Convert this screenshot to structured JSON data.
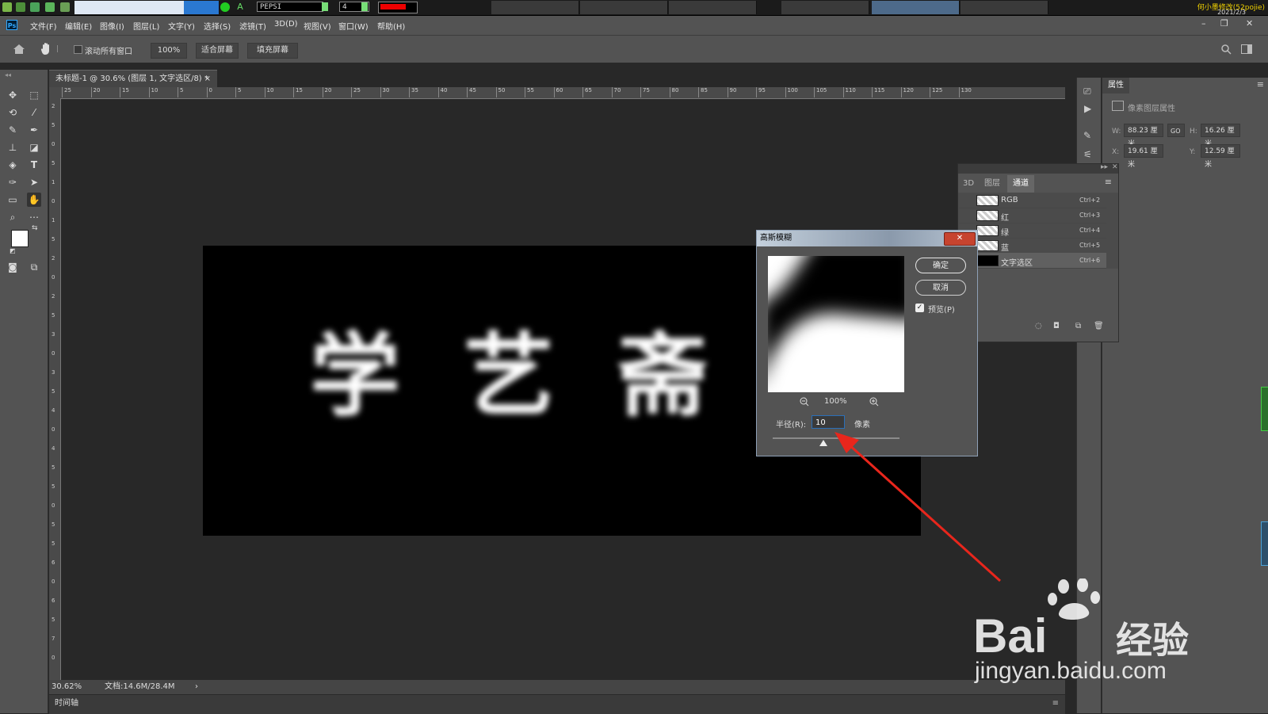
{
  "taskbar": {
    "text_field": "PEPSI",
    "num_field": "4",
    "brush_color": "#e00000",
    "right_text": "何小墨修改(52pojie)",
    "date": "2021/2/3"
  },
  "menubar": {
    "logo": "Ps",
    "items": [
      "文件(F)",
      "编辑(E)",
      "图像(I)",
      "图层(L)",
      "文字(Y)",
      "选择(S)",
      "滤镜(T)",
      "3D(D)",
      "视图(V)",
      "窗口(W)",
      "帮助(H)"
    ],
    "win_min": "–",
    "win_restore": "❐",
    "win_close": "✕"
  },
  "options": {
    "scroll_all_label": "滚动所有窗口",
    "zoom_value": "100%",
    "fit_screen": "适合屏幕",
    "fill_screen": "填充屏幕"
  },
  "document": {
    "tab_title": "未标题-1 @ 30.6% (图层 1, 文字选区/8) *",
    "tab_close": "×",
    "image_text": "学艺斋",
    "zoom": "30.62%",
    "doc_size": "文档:14.6M/28.4M",
    "status_arrow": "›"
  },
  "ruler": {
    "top_ticks": [
      "25",
      "20",
      "15",
      "10",
      "5",
      "0",
      "5",
      "10",
      "15",
      "20",
      "25",
      "30",
      "35",
      "40",
      "45",
      "50",
      "55",
      "60",
      "65",
      "70",
      "75",
      "80",
      "85",
      "90",
      "95",
      "100",
      "105",
      "110",
      "115",
      "120",
      "125",
      "130"
    ],
    "left_ticks": [
      "2",
      "5",
      "0",
      "5",
      "1",
      "0",
      "1",
      "5",
      "2",
      "0",
      "2",
      "5",
      "3",
      "0",
      "3",
      "5",
      "4",
      "0",
      "4",
      "5",
      "5",
      "0",
      "5",
      "5",
      "6",
      "0",
      "6",
      "5",
      "7",
      "0"
    ]
  },
  "timeline": {
    "label": "时间轴"
  },
  "properties": {
    "tab": "属性",
    "sub": "像素图层属性",
    "w_label": "W:",
    "w_value": "88.23 厘米",
    "link": "GO",
    "h_label": "H:",
    "h_value": "16.26 厘米",
    "x_label": "X:",
    "x_value": "19.61 厘米",
    "y_label": "Y:",
    "y_value": "12.59 厘米"
  },
  "channels": {
    "tabs": [
      "3D",
      "图层",
      "通道"
    ],
    "rows": [
      {
        "name": "RGB",
        "shortcut": "Ctrl+2"
      },
      {
        "name": "红",
        "shortcut": "Ctrl+3"
      },
      {
        "name": "绿",
        "shortcut": "Ctrl+4"
      },
      {
        "name": "蓝",
        "shortcut": "Ctrl+5"
      },
      {
        "name": "文字选区",
        "shortcut": "Ctrl+6"
      }
    ]
  },
  "dialog": {
    "title": "高斯模糊",
    "close": "✕",
    "ok": "确定",
    "cancel": "取消",
    "preview_label": "预览(P)",
    "preview_checked": true,
    "zoom": "100%",
    "radius_label": "半径(R):",
    "radius_value": "10",
    "radius_unit": "像素",
    "slider_fraction": 0.4
  },
  "watermark": {
    "brand": "Bai",
    "brand_cn": "经验",
    "url": "jingyan.baidu.com"
  },
  "colors": {
    "accent_arrow": "#e8261c",
    "panel_bg": "#535353",
    "canvas_bg": "#282828"
  }
}
